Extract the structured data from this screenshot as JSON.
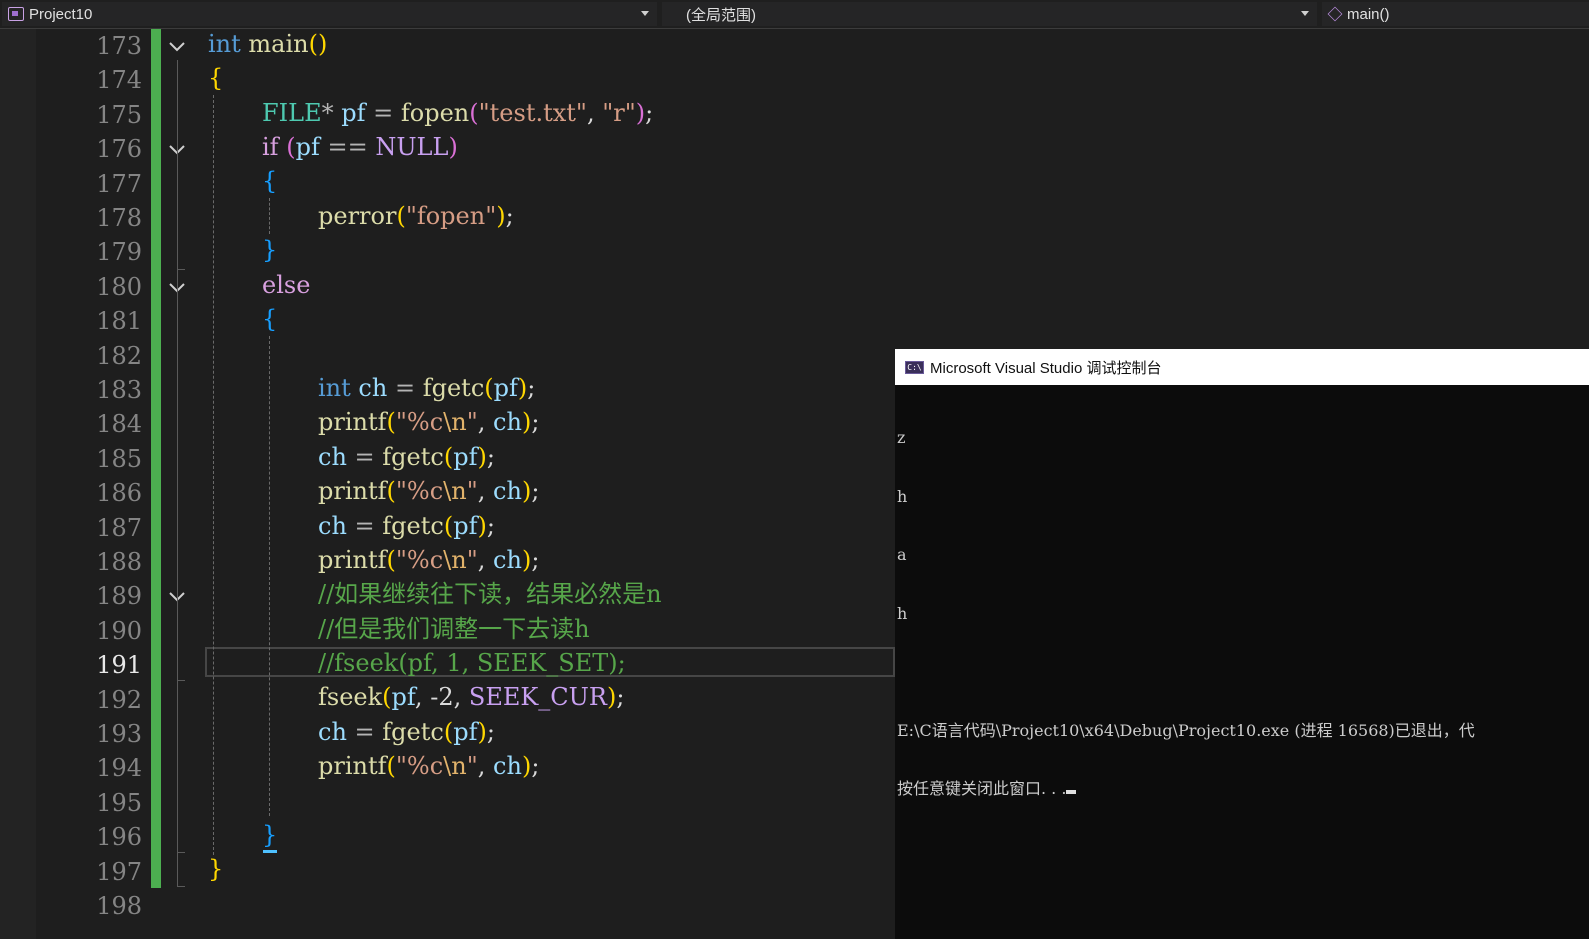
{
  "navbar": {
    "project": "Project10",
    "scope": "(全局范围)",
    "member": "main()"
  },
  "editor": {
    "current_line": 191,
    "line_numbers": [
      "173",
      "174",
      "175",
      "176",
      "177",
      "178",
      "179",
      "180",
      "181",
      "182",
      "183",
      "184",
      "185",
      "186",
      "187",
      "188",
      "189",
      "190",
      "191",
      "192",
      "193",
      "194",
      "195",
      "196",
      "197",
      "198"
    ],
    "code": {
      "l173_kw": "int",
      "l173_fn": "main",
      "l173_paren": "()",
      "l174_brace": "{",
      "l175_type": "FILE",
      "l175_star": "*",
      "l175_var": "pf",
      "l175_eq": "=",
      "l175_fn": "fopen",
      "l175_s1": "\"test.txt\"",
      "l175_comma": ",",
      "l175_s2": "\"r\"",
      "l175_semi": ";",
      "l176_kw": "if",
      "l176_var": "pf",
      "l176_op": "==",
      "l176_mac": "NULL",
      "l177_brace": "{",
      "l178_fn": "perror",
      "l178_str": "\"fopen\"",
      "l178_semi": ";",
      "l179_brace": "}",
      "l180_kw": "else",
      "l181_brace": "{",
      "l183_kw": "int",
      "l183_var": "ch",
      "l183_eq": "=",
      "l183_fn": "fgetc",
      "l183_arg": "pf",
      "l183_semi": ";",
      "printf": "printf",
      "fmt_q1": "\"%c",
      "fmt_esc": "\\n",
      "fmt_q2": "\"",
      "comma": ",",
      "ch": "ch",
      "semi": ";",
      "eq": "=",
      "fgetc": "fgetc",
      "pf": "pf",
      "l189_comment": "//如果继续往下读，结果必然是n",
      "l190_comment": "//但是我们调整一下去读h",
      "l191_comment": "//fseek(pf, 1, SEEK_SET);",
      "l192_fn": "fseek",
      "l192_num": "-2",
      "l192_mac": "SEEK_CUR",
      "l196_brace": "}",
      "l197_brace": "}"
    }
  },
  "console": {
    "title": "Microsoft Visual Studio 调试控制台",
    "icon_text": "C:\\",
    "lines": [
      "z",
      "h",
      "a",
      "h",
      "",
      "E:\\C语言代码\\Project10\\x64\\Debug\\Project10.exe (进程 16568)已退出，代",
      "按任意键关闭此窗口. . ."
    ]
  }
}
